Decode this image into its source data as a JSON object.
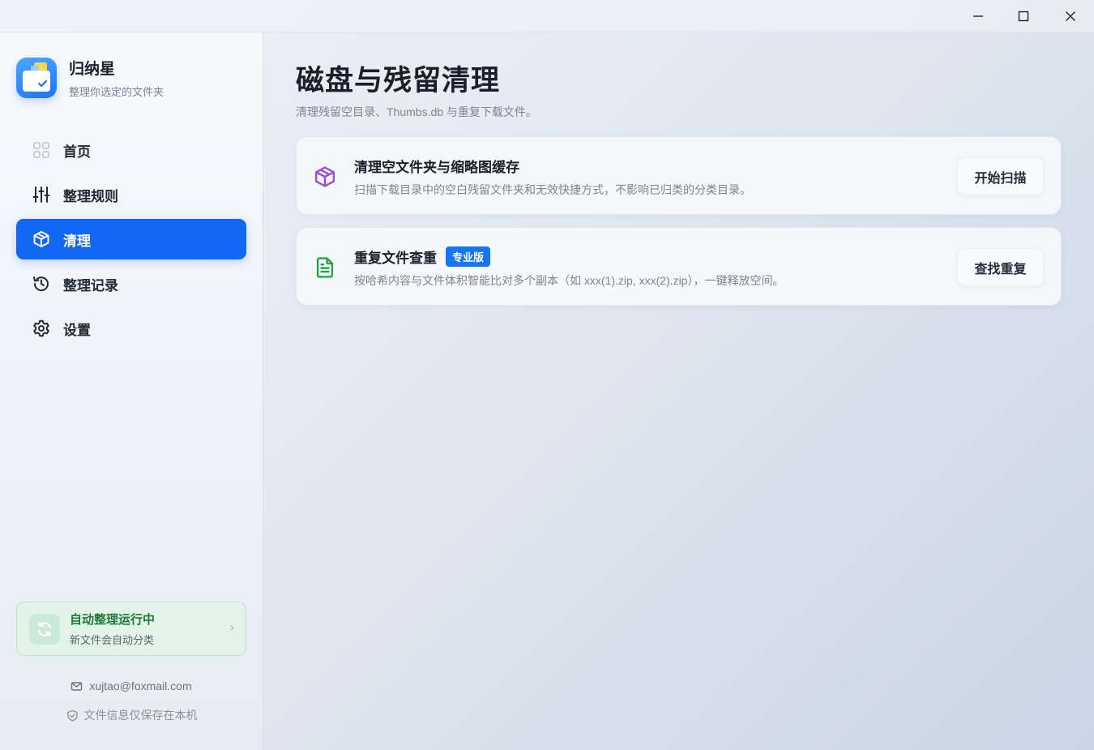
{
  "window": {
    "controls": [
      "minimize-icon",
      "maximize-icon",
      "close-icon"
    ]
  },
  "brand": {
    "name": "归纳星",
    "tagline": "整理你选定的文件夹",
    "logo_icon": "folder-check-icon"
  },
  "nav": {
    "items": [
      {
        "label": "首页",
        "icon": "grid-icon",
        "active": false
      },
      {
        "label": "整理规则",
        "icon": "sliders-icon",
        "active": false
      },
      {
        "label": "清理",
        "icon": "box-icon",
        "active": true
      },
      {
        "label": "整理记录",
        "icon": "history-icon",
        "active": false
      },
      {
        "label": "设置",
        "icon": "gear-icon",
        "active": false
      }
    ]
  },
  "auto": {
    "title": "自动整理运行中",
    "subtitle": "新文件会自动分类",
    "chevron": "›"
  },
  "footer": {
    "email": "xujtao@foxmail.com",
    "privacy": "文件信息仅保存在本机"
  },
  "main": {
    "title": "磁盘与残留清理",
    "subtitle": "清理残留空目录、Thumbs.db 与重复下载文件。",
    "cards": [
      {
        "title": "清理空文件夹与缩略图缓存",
        "description": "扫描下载目录中的空白残留文件夹和无效快捷方式，不影响已归类的分类目录。",
        "button": "开始扫描",
        "icon": "package-icon",
        "icon_color": "#a14ad8"
      },
      {
        "title": "重复文件查重",
        "badge": "专业版",
        "description": "按哈希内容与文件体积智能比对多个副本（如 xxx(1).zip, xxx(2).zip），一键释放空间。",
        "button": "查找重复",
        "icon": "file-text-icon",
        "icon_color": "#26a34a"
      }
    ]
  },
  "colors": {
    "accent": "#1268f4",
    "success": "#1f7a3a",
    "badge": "#1675f2"
  }
}
